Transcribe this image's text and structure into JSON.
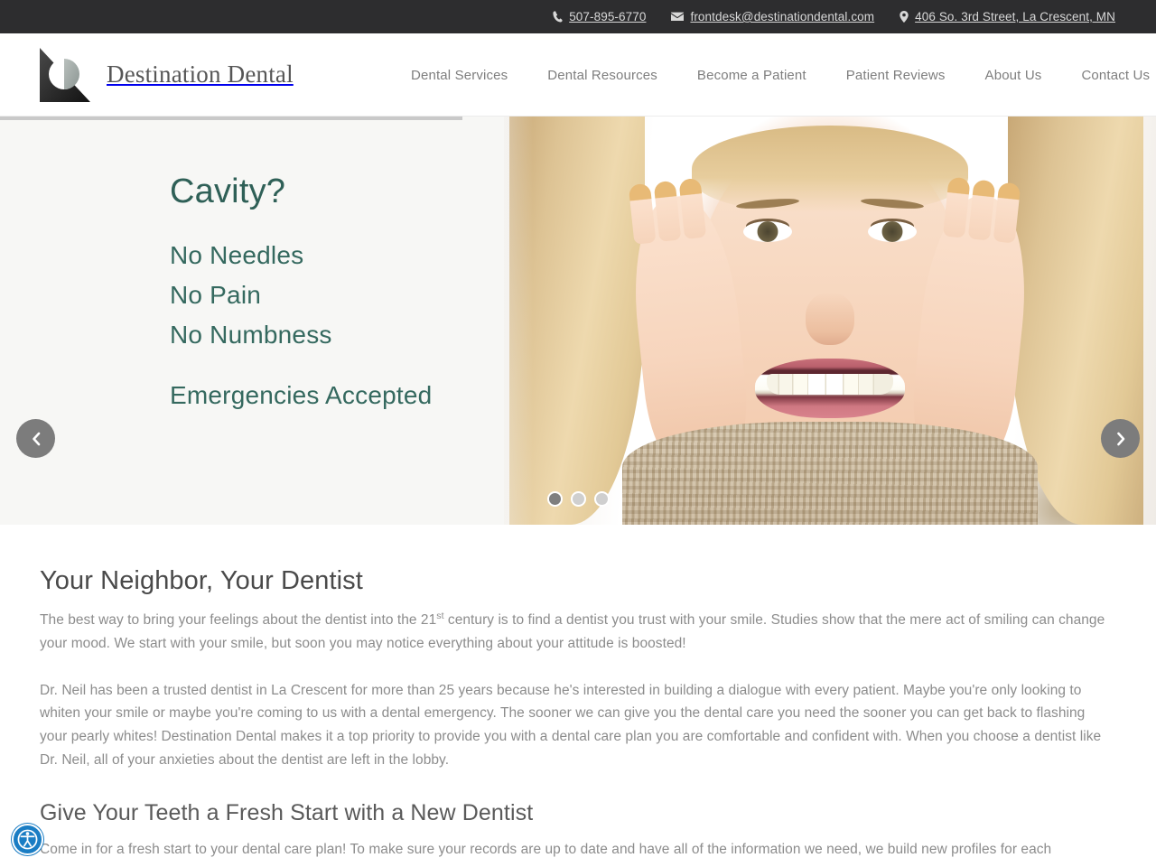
{
  "topbar": {
    "phone": "507-895-6770",
    "email": "frontdesk@destinationdental.com",
    "address": "406 So. 3rd Street, La Crescent, MN",
    "phone_icon": "phone-icon",
    "email_icon": "envelope-icon",
    "address_icon": "map-pin-icon",
    "background": "#2d2d2f",
    "text_color": "#d8d8d8"
  },
  "header": {
    "brand": "Destination Dental",
    "nav": [
      {
        "label": "Dental Services"
      },
      {
        "label": "Dental Resources"
      },
      {
        "label": "Become a Patient"
      },
      {
        "label": "Patient Reviews"
      },
      {
        "label": "About Us"
      },
      {
        "label": "Contact Us"
      }
    ]
  },
  "hero": {
    "heading": "Cavity?",
    "lines": [
      "No Needles",
      "No Pain",
      "No Numbness"
    ],
    "subheading": "Emergencies Accepted",
    "accent_color": "#2f6057",
    "panel_background": "#f7f7f5",
    "prev_label": "‹",
    "next_label": "›",
    "slide_count": 3,
    "active_slide": 1
  },
  "main": {
    "section1": {
      "heading": "Your Neighbor, Your Dentist",
      "paragraph1_pre": "The best way to bring your feelings about the dentist into the 21",
      "paragraph1_sup": "st",
      "paragraph1_post": " century is to find a dentist you trust with your smile. Studies show that the mere act of smiling can change your mood. We start with your smile, but soon you may notice everything about your attitude is boosted!",
      "paragraph2": "Dr. Neil has been a trusted dentist in La Crescent for more than 25 years because he's interested in building a dialogue with every patient. Maybe you're only looking to whiten your smile or maybe you're coming to us with a dental emergency. The sooner we can give you the dental care you need the sooner you can get back to flashing your pearly whites! Destination Dental makes it a top priority to provide you with a dental care plan you are comfortable and confident with. When you choose a dentist like Dr. Neil, all of your anxieties about the dentist are left in the lobby."
    },
    "section2": {
      "heading": "Give Your Teeth a Fresh Start with a New Dentist",
      "paragraph1": "Come in for a fresh start to your dental care plan! To make sure your records are up to date and have all of the information we need, we build new profiles for each"
    }
  },
  "accessibility": {
    "icon": "accessibility-icon",
    "color": "#1a7dc4"
  }
}
